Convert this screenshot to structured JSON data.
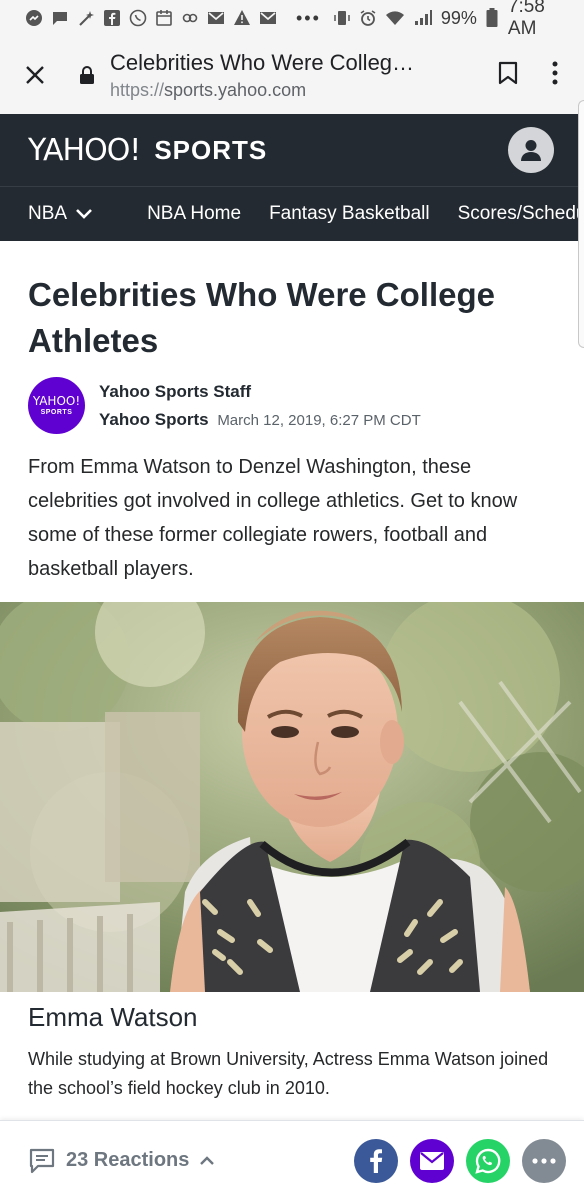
{
  "status_bar": {
    "battery": "99%",
    "time": "7:58 AM",
    "overflow": "•••"
  },
  "browser": {
    "page_title": "Celebrities Who Were Colleg…",
    "url_protocol": "https://",
    "url_host": "sports.yahoo.com"
  },
  "site": {
    "logo": "YAHOO!",
    "section": "SPORTS"
  },
  "nav": {
    "current": "NBA",
    "items": [
      "NBA Home",
      "Fantasy Basketball",
      "Scores/Schedule"
    ]
  },
  "article": {
    "headline": "Celebrities Who Were College Athletes",
    "author": "Yahoo Sports Staff",
    "publisher": "Yahoo Sports",
    "date": "March 12, 2019, 6:27 PM CDT",
    "author_logo_line1": "YAHOO!",
    "author_logo_line2": "SPORTS",
    "summary": "From Emma Watson to Denzel Washington, these celebrities got involved in college athletics. Get to know some of these former collegiate rowers, football and basketball players.",
    "slide_title": "Emma Watson",
    "slide_text": "While studying at Brown University, Actress Emma Watson joined the school’s field hockey club in 2010."
  },
  "bottom_bar": {
    "reactions": "23 Reactions"
  },
  "colors": {
    "header_bg": "#232a31",
    "yahoo_purple": "#5f01d1",
    "facebook": "#3b5998",
    "whatsapp": "#25d366"
  }
}
